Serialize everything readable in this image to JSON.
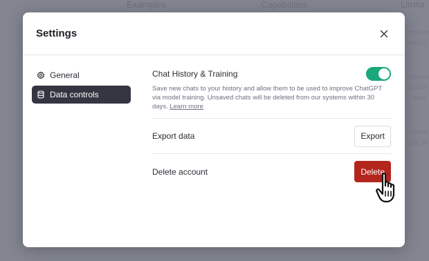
{
  "background": {
    "headings": [
      "Examples",
      "Capabilities",
      "Limita"
    ],
    "fragments": [
      "ccasion",
      "rrect in",
      "ccasion",
      "nstruct",
      "cont",
      "nowled",
      "ents af"
    ]
  },
  "modal": {
    "title": "Settings",
    "close_icon": "close-icon"
  },
  "sidebar": {
    "items": [
      {
        "label": "General",
        "icon": "gear-icon",
        "active": false
      },
      {
        "label": "Data controls",
        "icon": "database-icon",
        "active": true
      }
    ]
  },
  "chat_history": {
    "label": "Chat History & Training",
    "enabled": true,
    "description": "Save new chats to your history and allow them to be used to improve ChatGPT via model training. Unsaved chats will be deleted from our systems within 30 days.",
    "learn_more": "Learn more"
  },
  "export": {
    "label": "Export data",
    "button": "Export"
  },
  "delete": {
    "label": "Delete account",
    "button": "Delete"
  },
  "colors": {
    "toggle_on": "#19a87a",
    "delete_button": "#b3261e",
    "active_sidebar": "#343541"
  }
}
